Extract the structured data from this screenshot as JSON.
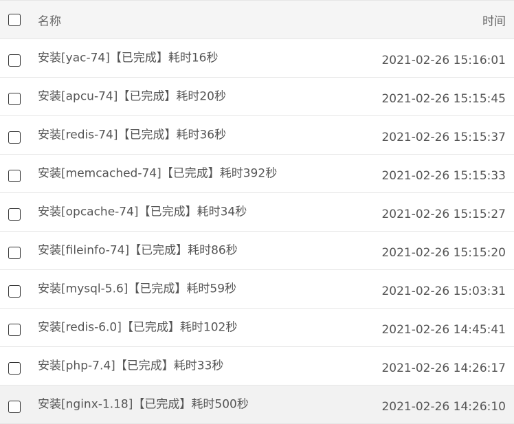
{
  "table": {
    "header": {
      "name_label": "名称",
      "time_label": "时间"
    },
    "rows": [
      {
        "name": "安装[yac-74]【已完成】耗时16秒",
        "time": "2021-02-26 15:16:01"
      },
      {
        "name": "安装[apcu-74]【已完成】耗时20秒",
        "time": "2021-02-26 15:15:45"
      },
      {
        "name": "安装[redis-74]【已完成】耗时36秒",
        "time": "2021-02-26 15:15:37"
      },
      {
        "name": "安装[memcached-74]【已完成】耗时392秒",
        "time": "2021-02-26 15:15:33"
      },
      {
        "name": "安装[opcache-74]【已完成】耗时34秒",
        "time": "2021-02-26 15:15:27"
      },
      {
        "name": "安装[fileinfo-74]【已完成】耗时86秒",
        "time": "2021-02-26 15:15:20"
      },
      {
        "name": "安装[mysql-5.6]【已完成】耗时59秒",
        "time": "2021-02-26 15:03:31"
      },
      {
        "name": "安装[redis-6.0]【已完成】耗时102秒",
        "time": "2021-02-26 14:45:41"
      },
      {
        "name": "安装[php-7.4]【已完成】耗时33秒",
        "time": "2021-02-26 14:26:17"
      },
      {
        "name": "安装[nginx-1.18]【已完成】耗时500秒",
        "time": "2021-02-26 14:26:10"
      }
    ]
  }
}
